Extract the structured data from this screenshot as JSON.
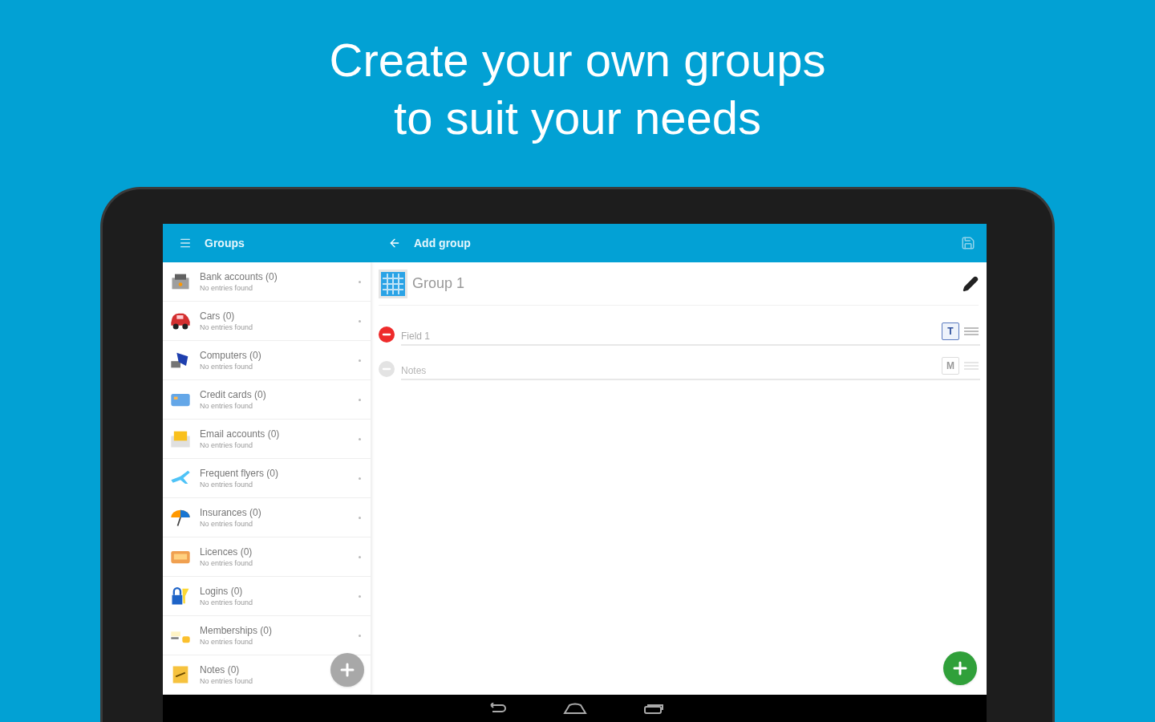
{
  "headline": [
    "Create your own groups",
    "to suit your needs"
  ],
  "left_bar": {
    "title": "Groups"
  },
  "groups": [
    {
      "name": "Bank accounts (0)",
      "subtitle": "No entries found"
    },
    {
      "name": "Cars (0)",
      "subtitle": "No entries found"
    },
    {
      "name": "Computers (0)",
      "subtitle": "No entries found"
    },
    {
      "name": "Credit cards (0)",
      "subtitle": "No entries found"
    },
    {
      "name": "Email accounts (0)",
      "subtitle": "No entries found"
    },
    {
      "name": "Frequent flyers (0)",
      "subtitle": "No entries found"
    },
    {
      "name": "Insurances (0)",
      "subtitle": "No entries found"
    },
    {
      "name": "Licences (0)",
      "subtitle": "No entries found"
    },
    {
      "name": "Logins (0)",
      "subtitle": "No entries found"
    },
    {
      "name": "Memberships (0)",
      "subtitle": "No entries found"
    },
    {
      "name": "Notes (0)",
      "subtitle": "No entries found"
    }
  ],
  "right_bar": {
    "title": "Add group"
  },
  "group_name": "Group 1",
  "fields": [
    {
      "placeholder": "Field 1",
      "type_letter": "T",
      "disabled": false
    },
    {
      "placeholder": "Notes",
      "type_letter": "M",
      "disabled": true
    }
  ]
}
